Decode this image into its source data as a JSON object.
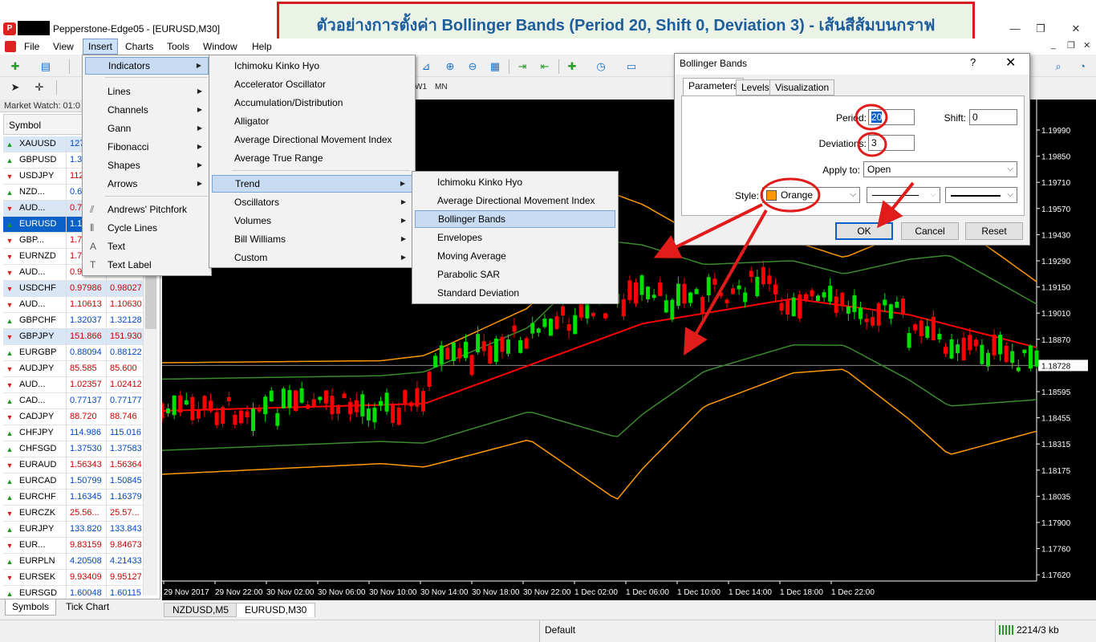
{
  "window": {
    "title": "Pepperstone-Edge05 - [EURUSD,M30]",
    "logo_text": "P",
    "minimize": "—",
    "maximize": "❐",
    "close": "✕",
    "mdi_minimize": "_",
    "mdi_restore": "❐",
    "mdi_close": "✕"
  },
  "banner": {
    "text": "ตัวอย่างการตั้งค่า Bollinger Bands (Period 20, Shift 0, Deviation 3) - เส้นสีส้มบนกราฟ"
  },
  "menubar": [
    "File",
    "View",
    "Insert",
    "Charts",
    "Tools",
    "Window",
    "Help"
  ],
  "toolbar": {
    "timeframes": [
      "W1",
      "MN"
    ]
  },
  "insert_menu": {
    "items": [
      "Indicators",
      "Lines",
      "Channels",
      "Gann",
      "Fibonacci",
      "Shapes",
      "Arrows",
      "Andrews' Pitchfork",
      "Cycle Lines",
      "Text",
      "Text Label"
    ]
  },
  "indicators_menu": {
    "items": [
      "Ichimoku Kinko Hyo",
      "Accelerator Oscillator",
      "Accumulation/Distribution",
      "Alligator",
      "Average Directional Movement Index",
      "Average True Range",
      "Trend",
      "Oscillators",
      "Volumes",
      "Bill Williams",
      "Custom"
    ]
  },
  "trend_menu": {
    "items": [
      "Ichimoku Kinko Hyo",
      "Average Directional Movement Index",
      "Bollinger Bands",
      "Envelopes",
      "Moving Average",
      "Parabolic SAR",
      "Standard Deviation"
    ]
  },
  "market_watch": {
    "title": "Market Watch: 01:0",
    "headers": {
      "symbol": "Symbol"
    },
    "rows": [
      {
        "sym": "XAUUSD",
        "bid": "127",
        "ask": "",
        "dir": "up"
      },
      {
        "sym": "GBPUSD",
        "bid": "1.34",
        "ask": "",
        "dir": "up"
      },
      {
        "sym": "USDJPY",
        "bid": "112",
        "ask": "",
        "dir": "down"
      },
      {
        "sym": "NZD...",
        "bid": "0.6",
        "ask": "",
        "dir": "up"
      },
      {
        "sym": "AUD...",
        "bid": "0.7",
        "ask": "",
        "dir": "down"
      },
      {
        "sym": "EURUSD",
        "bid": "1.1",
        "ask": "",
        "dir": "up"
      },
      {
        "sym": "GBP...",
        "bid": "1.7",
        "ask": "",
        "dir": "down"
      },
      {
        "sym": "EURNZD",
        "bid": "1.7",
        "ask": "",
        "dir": "down"
      },
      {
        "sym": "AUD...",
        "bid": "0.9",
        "ask": "",
        "dir": "down"
      },
      {
        "sym": "USDCHF",
        "bid": "0.97986",
        "ask": "0.98027",
        "dir": "down"
      },
      {
        "sym": "AUD...",
        "bid": "1.10613",
        "ask": "1.10630",
        "dir": "down"
      },
      {
        "sym": "GBPCHF",
        "bid": "1.32037",
        "ask": "1.32128",
        "dir": "up"
      },
      {
        "sym": "GBPJPY",
        "bid": "151.866",
        "ask": "151.930",
        "dir": "down"
      },
      {
        "sym": "EURGBP",
        "bid": "0.88094",
        "ask": "0.88122",
        "dir": "up"
      },
      {
        "sym": "AUDJPY",
        "bid": "85.585",
        "ask": "85.600",
        "dir": "down"
      },
      {
        "sym": "AUD...",
        "bid": "1.02357",
        "ask": "1.02412",
        "dir": "down"
      },
      {
        "sym": "CAD...",
        "bid": "0.77137",
        "ask": "0.77177",
        "dir": "up"
      },
      {
        "sym": "CADJPY",
        "bid": "88.720",
        "ask": "88.746",
        "dir": "down"
      },
      {
        "sym": "CHFJPY",
        "bid": "114.986",
        "ask": "115.016",
        "dir": "up"
      },
      {
        "sym": "CHFSGD",
        "bid": "1.37530",
        "ask": "1.37583",
        "dir": "up"
      },
      {
        "sym": "EURAUD",
        "bid": "1.56343",
        "ask": "1.56364",
        "dir": "down"
      },
      {
        "sym": "EURCAD",
        "bid": "1.50799",
        "ask": "1.50845",
        "dir": "up"
      },
      {
        "sym": "EURCHF",
        "bid": "1.16345",
        "ask": "1.16379",
        "dir": "up"
      },
      {
        "sym": "EURCZK",
        "bid": "25.56...",
        "ask": "25.57...",
        "dir": "down"
      },
      {
        "sym": "EURJPY",
        "bid": "133.820",
        "ask": "133.843",
        "dir": "up"
      },
      {
        "sym": "EUR...",
        "bid": "9.83159",
        "ask": "9.84673",
        "dir": "down"
      },
      {
        "sym": "EURPLN",
        "bid": "4.20508",
        "ask": "4.21433",
        "dir": "up"
      },
      {
        "sym": "EURSEK",
        "bid": "9.93409",
        "ask": "9.95127",
        "dir": "down"
      },
      {
        "sym": "EURSGD",
        "bid": "1.60048",
        "ask": "1.60115",
        "dir": "up"
      }
    ],
    "tabs": [
      "Symbols",
      "Tick Chart"
    ]
  },
  "chart": {
    "price_levels": [
      "1.19990",
      "1.19850",
      "1.19710",
      "1.19570",
      "1.19430",
      "1.19290",
      "1.19150",
      "1.19010",
      "1.18870",
      "1.18728",
      "1.18595",
      "1.18455",
      "1.18315",
      "1.18175",
      "1.18035",
      "1.17900",
      "1.17760",
      "1.17620"
    ],
    "current_price": "1.18728",
    "time_labels": [
      "29 Nov 2017",
      "29 Nov 22:00",
      "30 Nov 02:00",
      "30 Nov 06:00",
      "30 Nov 10:00",
      "30 Nov 14:00",
      "30 Nov 18:00",
      "30 Nov 22:00",
      "1 Dec 02:00",
      "1 Dec 06:00",
      "1 Dec 10:00",
      "1 Dec 14:00",
      "1 Dec 18:00",
      "1 Dec 22:00"
    ],
    "tabs": [
      "NZDUSD,M5",
      "EURUSD,M30"
    ],
    "colors": {
      "bull": "#00e000",
      "bear": "#ff0000",
      "middle": "#ff0000",
      "inner": "#3b8a2e",
      "outer": "#ff9900"
    }
  },
  "dialog": {
    "title": "Bollinger Bands",
    "help": "?",
    "close": "✕",
    "tabs": [
      "Parameters",
      "Levels",
      "Visualization"
    ],
    "period_label": "Period:",
    "period_value": "20",
    "shift_label": "Shift:",
    "shift_value": "0",
    "deviations_label": "Deviations:",
    "deviations_value": "3",
    "apply_label": "Apply to:",
    "apply_value": "Open",
    "style_label": "Style:",
    "color_name": "Orange",
    "color_hex": "#ff9900",
    "ok": "OK",
    "cancel": "Cancel",
    "reset": "Reset"
  },
  "statusbar": {
    "profile": "Default",
    "traffic": "2214/3 kb"
  }
}
